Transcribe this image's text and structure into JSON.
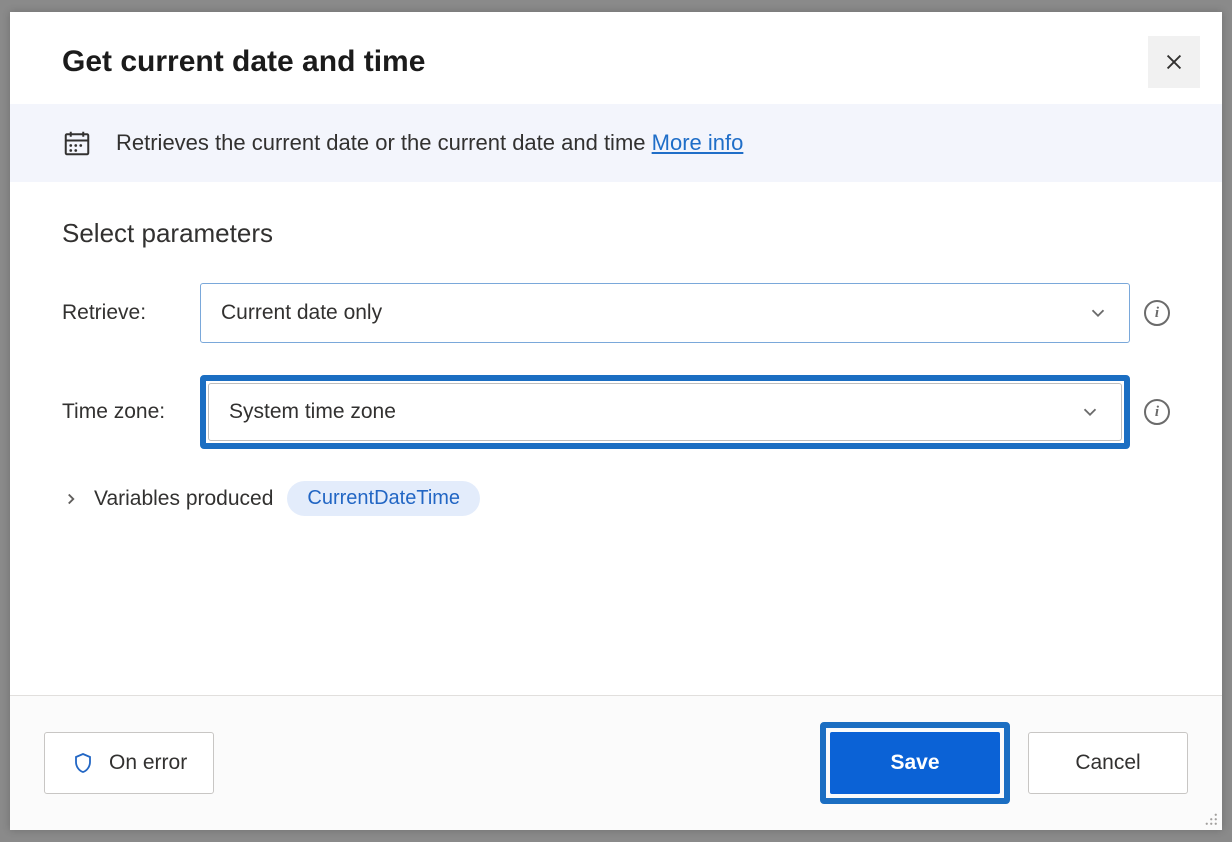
{
  "dialog": {
    "title": "Get current date and time",
    "description": "Retrieves the current date or the current date and time",
    "more_info_label": "More info"
  },
  "parameters": {
    "heading": "Select parameters",
    "retrieve": {
      "label": "Retrieve:",
      "value": "Current date only"
    },
    "timezone": {
      "label": "Time zone:",
      "value": "System time zone"
    }
  },
  "variables": {
    "label": "Variables produced",
    "items": [
      "CurrentDateTime"
    ]
  },
  "footer": {
    "on_error_label": "On error",
    "save_label": "Save",
    "cancel_label": "Cancel"
  }
}
